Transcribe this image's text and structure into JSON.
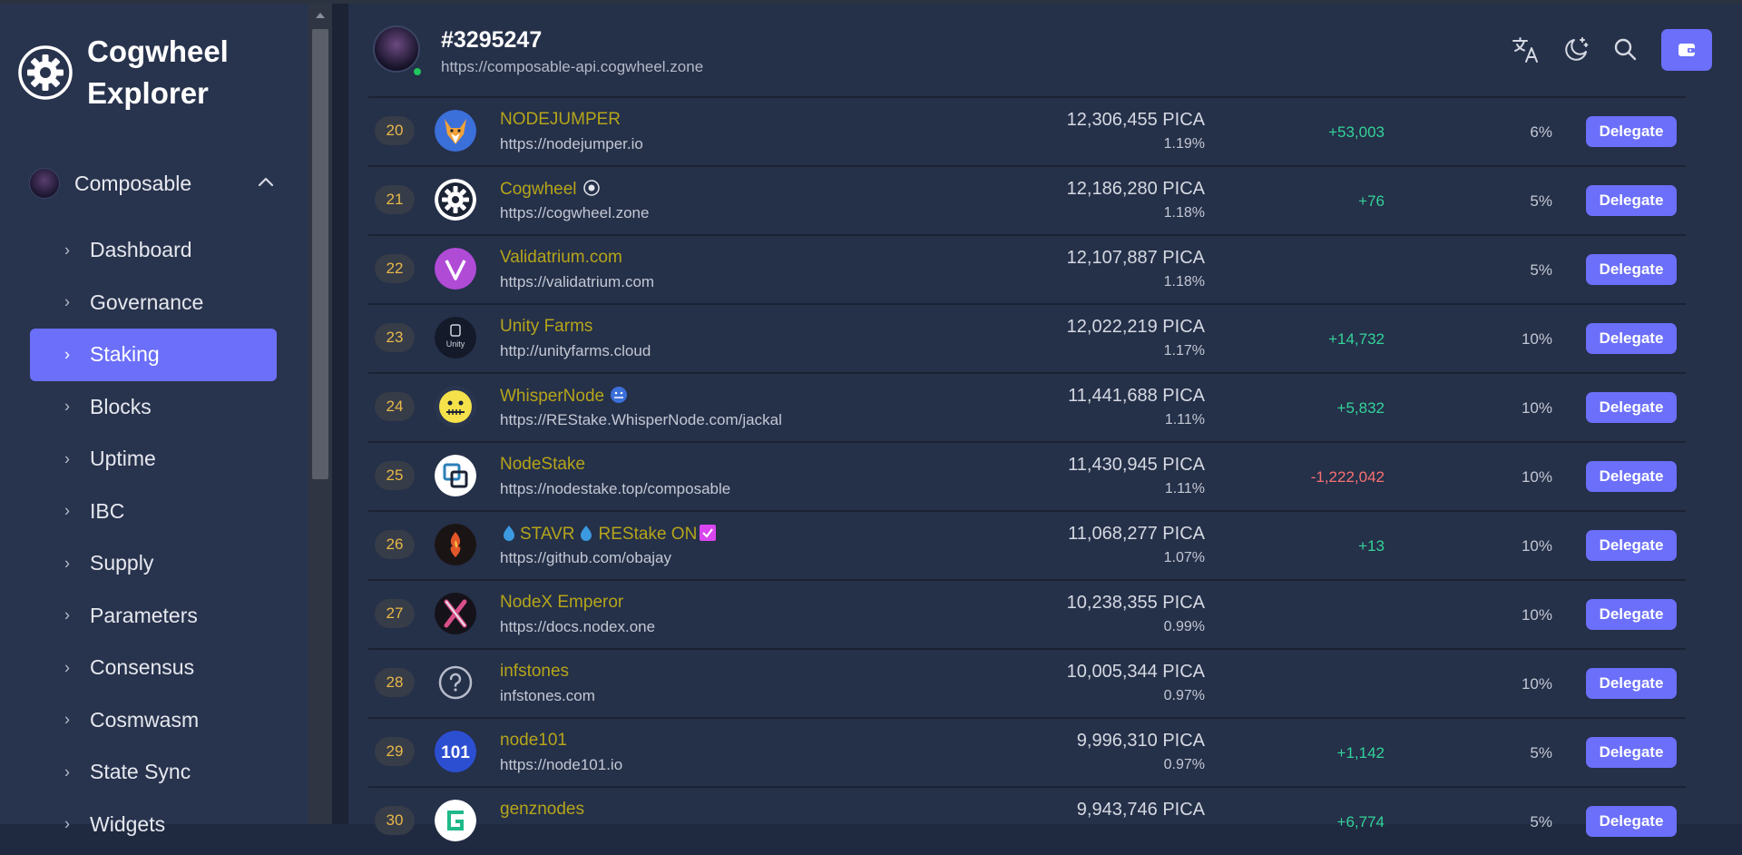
{
  "sidebar": {
    "brand": {
      "line1": "Cogwheel",
      "line2": "Explorer"
    },
    "chain": {
      "label": "Composable"
    },
    "items": [
      {
        "label": "Dashboard",
        "active": false
      },
      {
        "label": "Governance",
        "active": false
      },
      {
        "label": "Staking",
        "active": true
      },
      {
        "label": "Blocks",
        "active": false
      },
      {
        "label": "Uptime",
        "active": false
      },
      {
        "label": "IBC",
        "active": false
      },
      {
        "label": "Supply",
        "active": false
      },
      {
        "label": "Parameters",
        "active": false
      },
      {
        "label": "Consensus",
        "active": false
      },
      {
        "label": "Cosmwasm",
        "active": false
      },
      {
        "label": "State Sync",
        "active": false
      },
      {
        "label": "Widgets",
        "active": false
      }
    ]
  },
  "header": {
    "title": "#3295247",
    "url": "https://composable-api.cogwheel.zone",
    "icons": [
      "translate-icon",
      "dark-mode-icon",
      "search-icon",
      "wallet-icon"
    ]
  },
  "colors": {
    "accent": "#6b6ff9",
    "name": "#b5a51a",
    "positive": "#34d399",
    "negative": "#f87171",
    "rank": "#e9b84a"
  },
  "validators": [
    {
      "rank": "20",
      "name": "NODEJUMPER",
      "url": "https://nodejumper.io",
      "power": "12,306,455 PICA",
      "percent": "1.19%",
      "change": "+53,003",
      "commission": "6%",
      "action": "Delegate",
      "logo": "fox-logo"
    },
    {
      "rank": "21",
      "name": "Cogwheel",
      "url": "https://cogwheel.zone",
      "power": "12,186,280 PICA",
      "percent": "1.18%",
      "change": "+76",
      "commission": "5%",
      "action": "Delegate",
      "logo": "cogwheel-logo"
    },
    {
      "rank": "22",
      "name": "Validatrium.com",
      "url": "https://validatrium.com",
      "power": "12,107,887 PICA",
      "percent": "1.18%",
      "change": "",
      "commission": "5%",
      "action": "Delegate",
      "logo": "validatrium-logo"
    },
    {
      "rank": "23",
      "name": "Unity Farms",
      "url": "http://unityfarms.cloud",
      "power": "12,022,219 PICA",
      "percent": "1.17%",
      "change": "+14,732",
      "commission": "10%",
      "action": "Delegate",
      "logo": "unity-logo"
    },
    {
      "rank": "24",
      "name": "WhisperNode",
      "url": "https://REStake.WhisperNode.com/jackal",
      "power": "11,441,688 PICA",
      "percent": "1.11%",
      "change": "+5,832",
      "commission": "10%",
      "action": "Delegate",
      "logo": "whisper-logo"
    },
    {
      "rank": "25",
      "name": "NodeStake",
      "url": "https://nodestake.top/composable",
      "power": "11,430,945 PICA",
      "percent": "1.11%",
      "change": "-1,222,042",
      "commission": "10%",
      "action": "Delegate",
      "logo": "nodestake-logo"
    },
    {
      "rank": "26",
      "name": "STAVR",
      "name_suffix": "REStake ON",
      "url": "https://github.com/obajay",
      "power": "11,068,277 PICA",
      "percent": "1.07%",
      "change": "+13",
      "commission": "10%",
      "action": "Delegate",
      "logo": "stavr-logo"
    },
    {
      "rank": "27",
      "name": "NodeX Emperor",
      "url": "https://docs.nodex.one",
      "power": "10,238,355 PICA",
      "percent": "0.99%",
      "change": "",
      "commission": "10%",
      "action": "Delegate",
      "logo": "nodex-logo"
    },
    {
      "rank": "28",
      "name": "infstones",
      "url": "infstones.com",
      "power": "10,005,344 PICA",
      "percent": "0.97%",
      "change": "",
      "commission": "10%",
      "action": "Delegate",
      "logo": "question-logo"
    },
    {
      "rank": "29",
      "name": "node101",
      "url": "https://node101.io",
      "power": "9,996,310 PICA",
      "percent": "0.97%",
      "change": "+1,142",
      "commission": "5%",
      "action": "Delegate",
      "logo": "node101-logo"
    },
    {
      "rank": "30",
      "name": "genznodes",
      "url": "",
      "power": "9,943,746 PICA",
      "percent": "",
      "change": "+6,774",
      "commission": "5%",
      "action": "Delegate",
      "logo": "genznodes-logo"
    }
  ]
}
